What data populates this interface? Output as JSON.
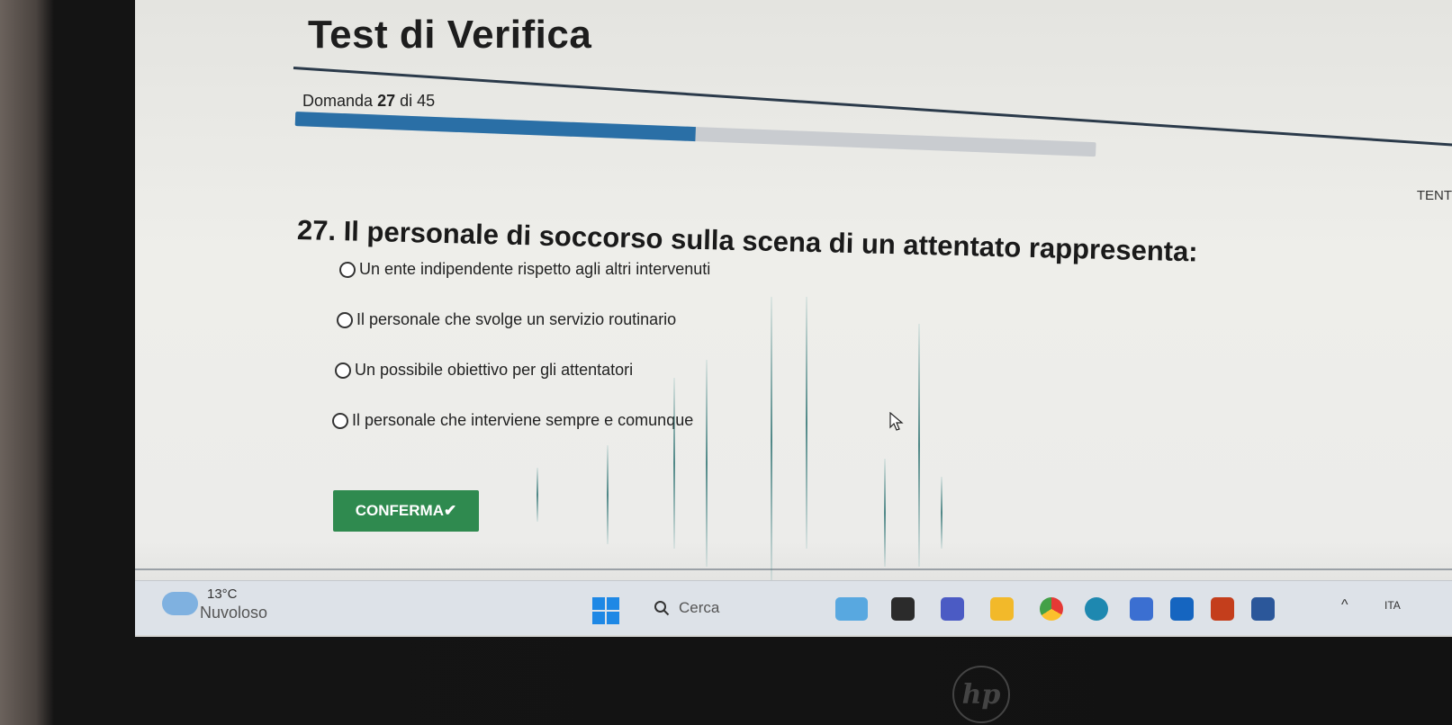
{
  "page": {
    "title": "Test di Verifica",
    "counter_prefix": "Domanda",
    "counter_current": "27",
    "counter_sep": "di",
    "counter_total": "45",
    "progress_fraction": 0.5,
    "attempts_label": "TENT"
  },
  "question": {
    "text": "27. Il personale di soccorso sulla scena di un attentato rappresenta:",
    "options": [
      {
        "label": "Un ente indipendente rispetto agli altri intervenuti"
      },
      {
        "label": "Il personale che svolge un servizio routinario"
      },
      {
        "label": "Un possibile obiettivo per gli attentatori"
      },
      {
        "label": "Il personale che interviene sempre e comunque"
      }
    ],
    "confirm_label": "CONFERMA✔"
  },
  "taskbar": {
    "weather_temp": "13°C",
    "weather_desc": "Nuvoloso",
    "search_placeholder": "Cerca",
    "lang": "ITA",
    "pinned_icons": [
      "widgets-icon",
      "file-explorer-icon",
      "teams-icon",
      "folder-icon",
      "chrome-icon",
      "edge-icon",
      "store-icon",
      "outlook-icon",
      "powerpoint-icon",
      "word-icon"
    ]
  },
  "colors": {
    "progress": "#2a6fa6",
    "confirm": "#2f8a4f",
    "windows_blue": "#1e88e5"
  }
}
